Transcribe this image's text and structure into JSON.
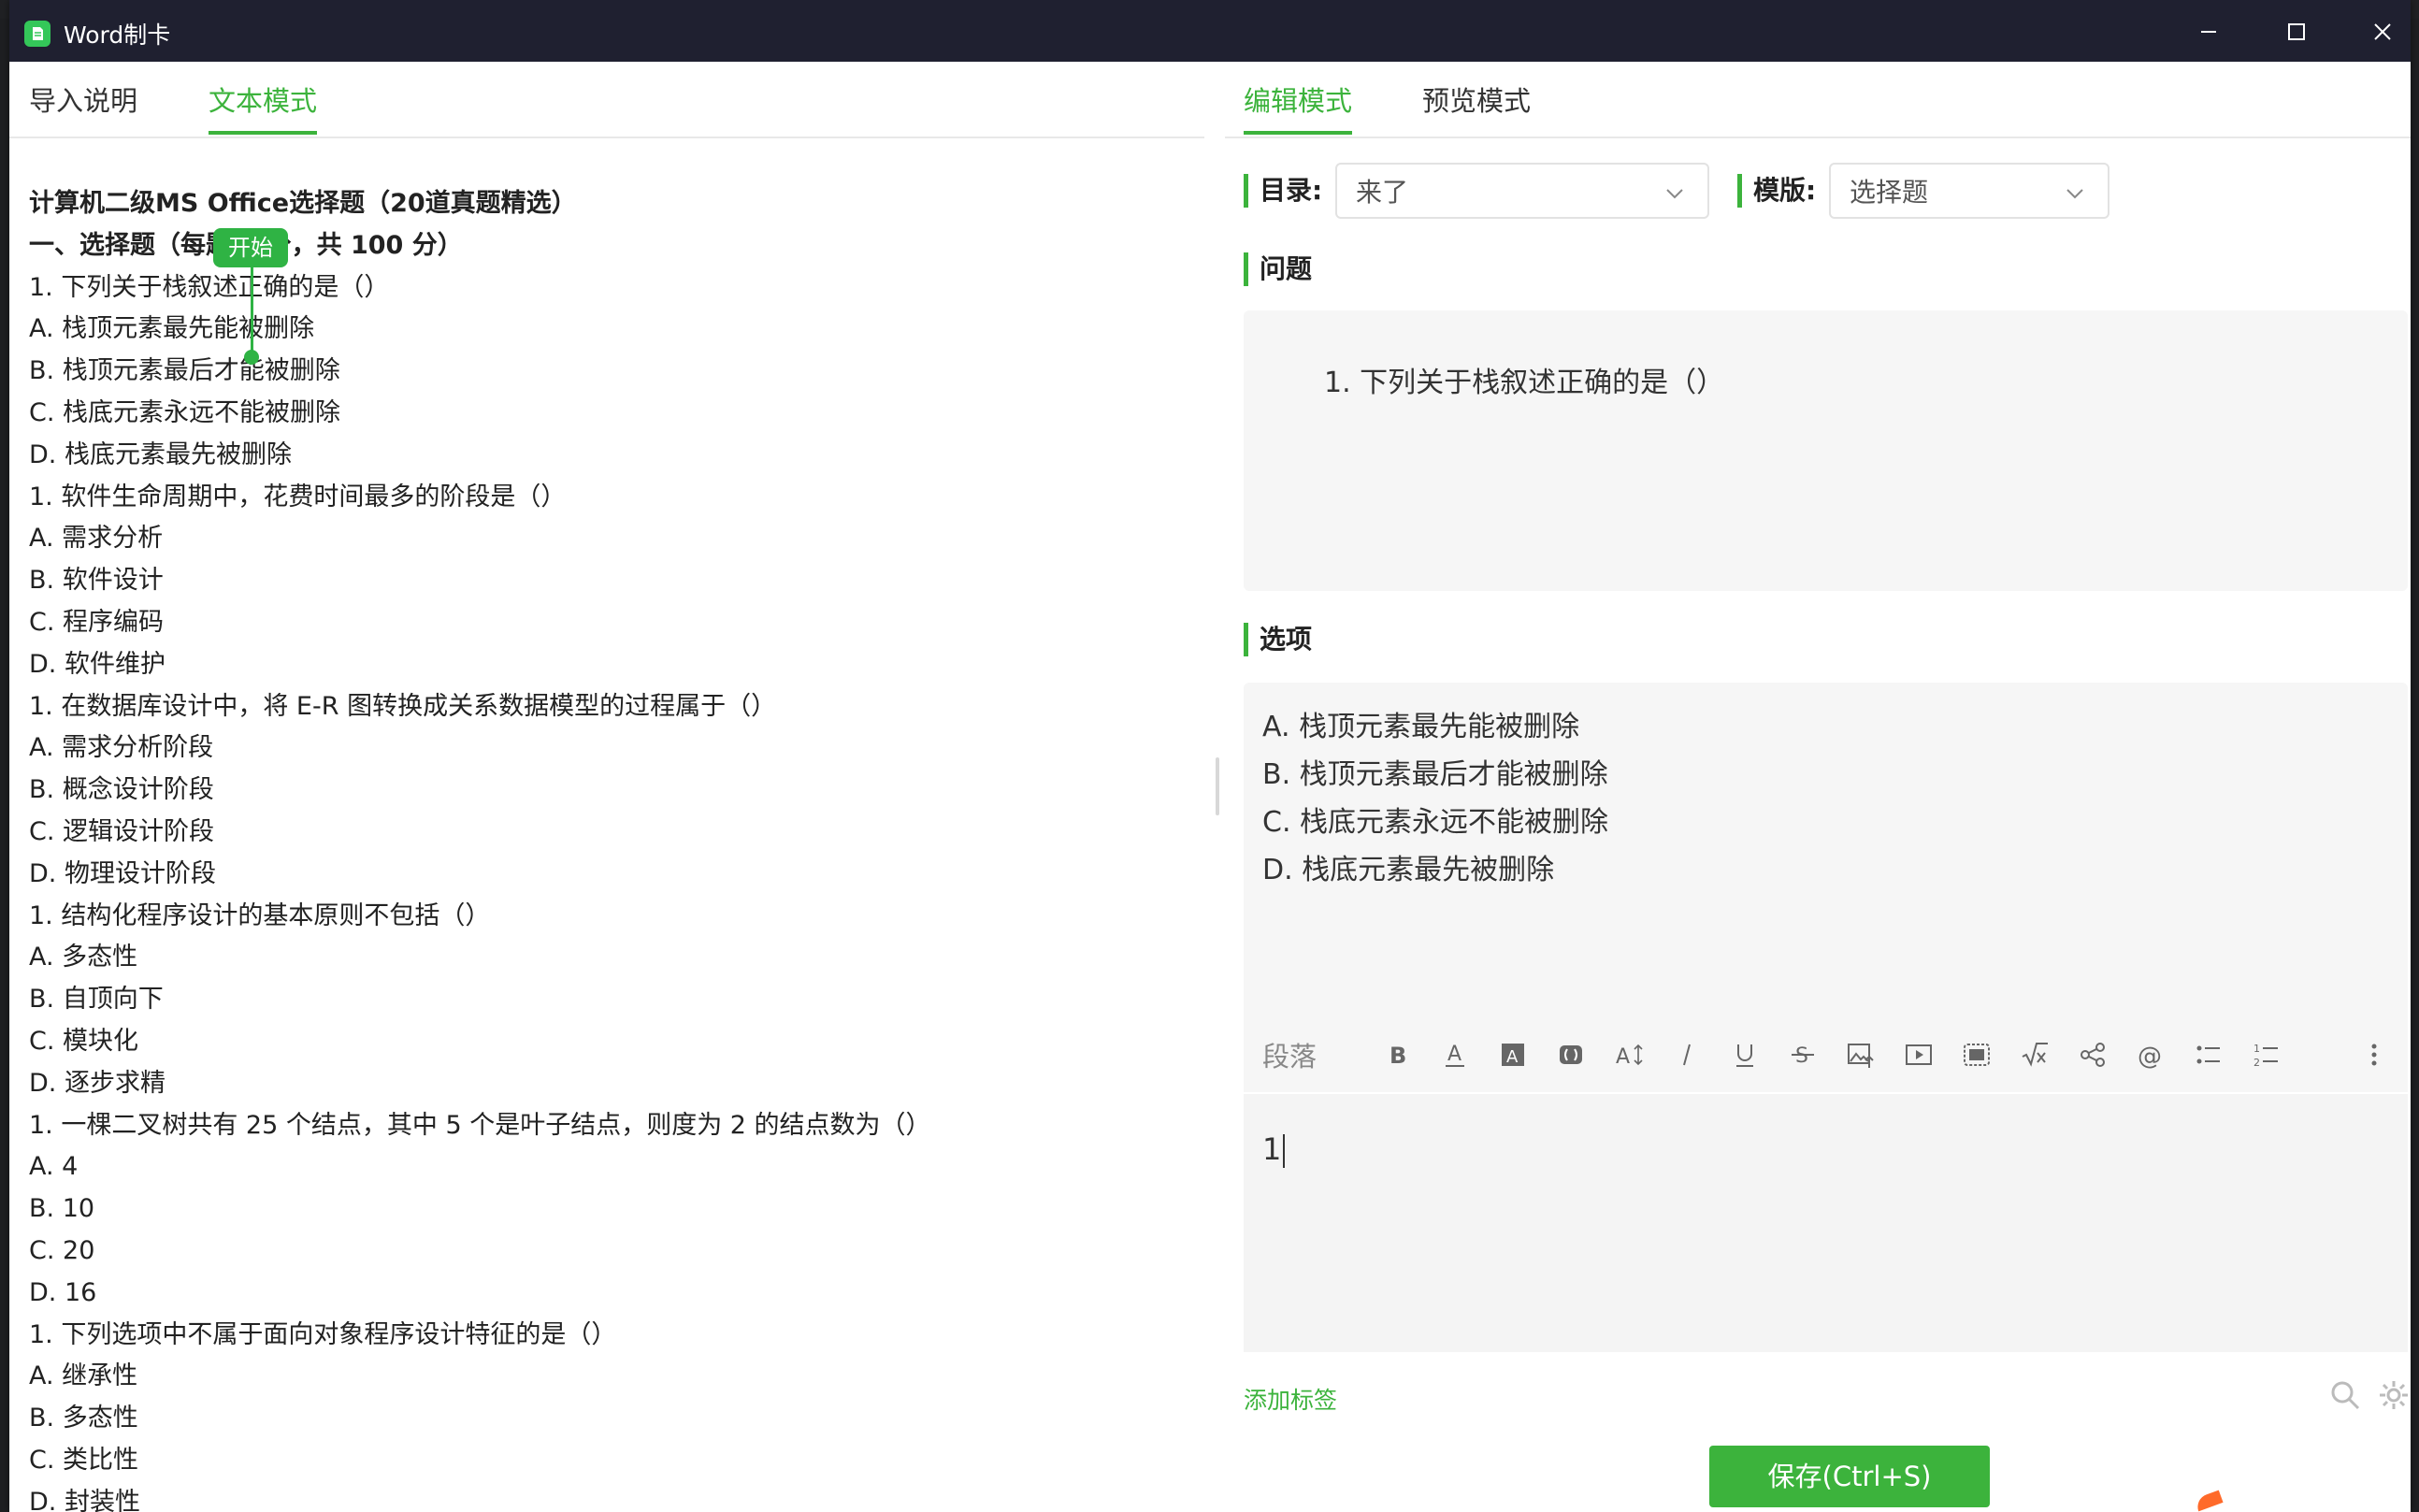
{
  "window": {
    "title": "Word制卡"
  },
  "left": {
    "tabs": [
      {
        "label": "导入说明",
        "active": false
      },
      {
        "label": "文本模式",
        "active": true
      }
    ],
    "bubble_label": "开始",
    "lines": [
      {
        "text": "计算机二级MS Office选择题（20道真题精选）",
        "bold": true
      },
      {
        "text": "一、选择题（每题 5 分，共 100 分）",
        "bold": true
      },
      {
        "text": "1. 下列关于栈叙述正确的是（）"
      },
      {
        "text": "A. 栈顶元素最先能被删除"
      },
      {
        "text": "B. 栈顶元素最后才能被删除"
      },
      {
        "text": "C. 栈底元素永远不能被删除"
      },
      {
        "text": "D. 栈底元素最先被删除"
      },
      {
        "text": "1. 软件生命周期中，花费时间最多的阶段是（）"
      },
      {
        "text": "A. 需求分析"
      },
      {
        "text": "B. 软件设计"
      },
      {
        "text": "C. 程序编码"
      },
      {
        "text": "D. 软件维护"
      },
      {
        "text": "1. 在数据库设计中，将 E-R 图转换成关系数据模型的过程属于（）"
      },
      {
        "text": "A. 需求分析阶段"
      },
      {
        "text": "B. 概念设计阶段"
      },
      {
        "text": "C. 逻辑设计阶段"
      },
      {
        "text": "D. 物理设计阶段"
      },
      {
        "text": "1. 结构化程序设计的基本原则不包括（）"
      },
      {
        "text": "A. 多态性"
      },
      {
        "text": "B. 自顶向下"
      },
      {
        "text": "C. 模块化"
      },
      {
        "text": "D. 逐步求精"
      },
      {
        "text": "1. 一棵二叉树共有 25 个结点，其中 5 个是叶子结点，则度为 2 的结点数为（）"
      },
      {
        "text": "A. 4"
      },
      {
        "text": "B. 10"
      },
      {
        "text": "C. 20"
      },
      {
        "text": "D. 16"
      },
      {
        "text": "1. 下列选项中不属于面向对象程序设计特征的是（）"
      },
      {
        "text": "A. 继承性"
      },
      {
        "text": "B. 多态性"
      },
      {
        "text": "C. 类比性"
      },
      {
        "text": "D. 封装性"
      }
    ]
  },
  "right": {
    "tabs": [
      {
        "label": "编辑模式",
        "active": true
      },
      {
        "label": "预览模式",
        "active": false
      }
    ],
    "catalog_label": "目录:",
    "catalog_value": "来了",
    "template_label": "模版:",
    "template_value": "选择题",
    "question_label": "问题",
    "question_text": "1. 下列关于栈叙述正确的是（）",
    "options_label": "选项",
    "options": [
      "A. 栈顶元素最先能被删除",
      "B. 栈顶元素最后才能被删除",
      "C. 栈底元素永远不能被删除",
      "D. 栈底元素最先被删除"
    ],
    "toolbar_paragraph": "段落",
    "toolbar_icons": [
      "bold-icon",
      "font-color-icon",
      "highlight-icon",
      "format-clear-icon",
      "font-size-icon",
      "italic-icon",
      "underline-icon",
      "strikethrough-icon",
      "insert-image-icon",
      "insert-video-icon",
      "insert-box-icon",
      "formula-icon",
      "share-icon",
      "mention-icon",
      "bullet-list-icon",
      "numbered-list-icon",
      "more-icon"
    ],
    "editor_text": "1",
    "add_tag_label": "添加标签",
    "save_label": "保存(Ctrl+S)"
  },
  "colors": {
    "accent": "#3cb33c",
    "titlebar": "#1f2030"
  }
}
